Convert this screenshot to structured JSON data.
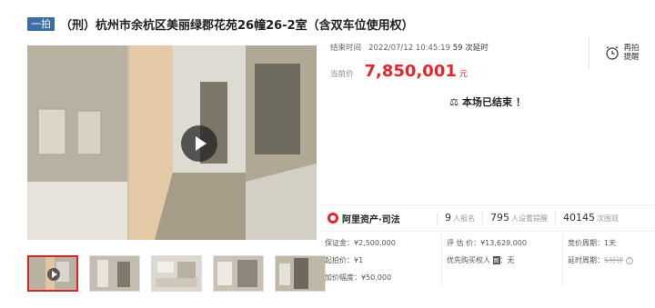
{
  "header": {
    "badge": "一拍",
    "title": "（刑）杭州市余杭区美丽绿郡花苑26幢26-2室（含双车位使用权）"
  },
  "auction": {
    "end_label": "结束时间",
    "end_time": "2022/07/12 10:45:19",
    "delay_count": "59 次延时",
    "price_label": "当前价",
    "price": "7,850,001",
    "price_unit": "元",
    "remind_label_1": "再拍",
    "remind_label_2": "提醒",
    "ended_text": "本场已结束 ！"
  },
  "stats": {
    "brand": "阿里资产·司法",
    "signups_value": "9",
    "signups_label": "人报名",
    "reminders_value": "795",
    "reminders_label": "人设置提醒",
    "views_value": "40145",
    "views_label": "次围观"
  },
  "details": {
    "deposit": "保证金：¥2,500,000",
    "start_price": "起拍价：¥1",
    "increment": "加价幅度：¥50,000",
    "appraisal": "评 估 价：¥13,629,000",
    "priority_label": "优先购买权人",
    "priority_tag": "图",
    "priority_value": "：无",
    "period": "竞价周期：1天",
    "delay_label": "延时周期：",
    "delay_value": "5分钟"
  },
  "media": {
    "thumbnails": [
      "video-thumb",
      "room-photo-1",
      "kitchen-photo",
      "room-photo-2",
      "room-photo-3"
    ]
  }
}
